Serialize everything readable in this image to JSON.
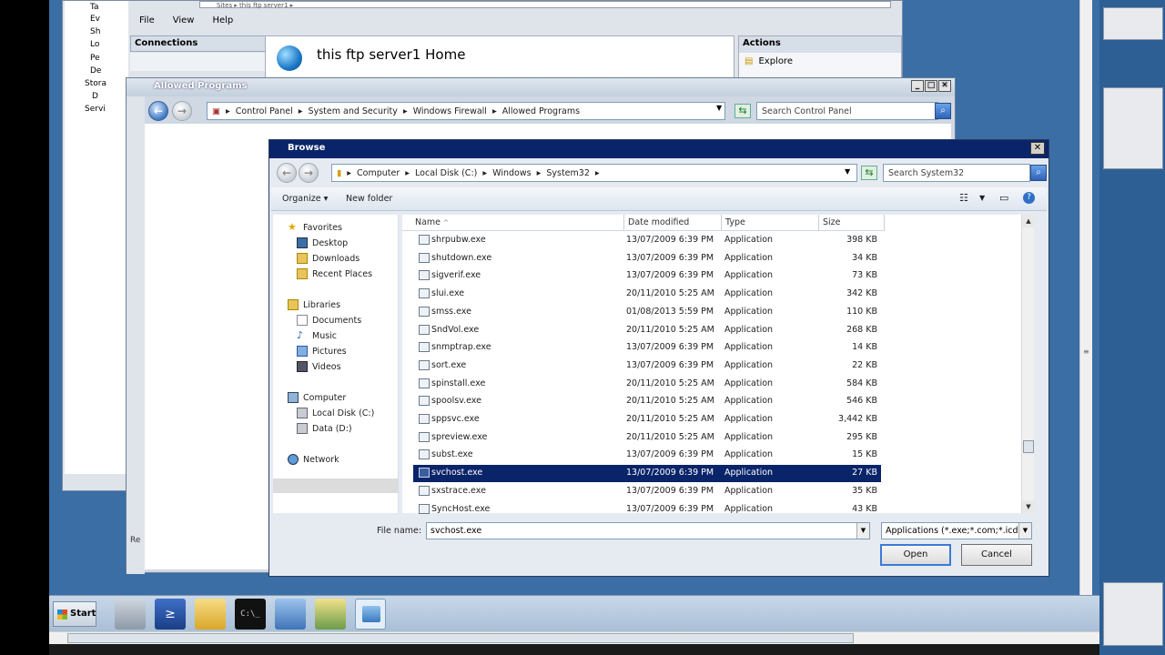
{
  "iis": {
    "menu": [
      "File",
      "View",
      "Help"
    ],
    "tree_items": [
      "Ta",
      "Ev",
      "Sh",
      "Lo",
      "Pe",
      "De",
      "Stora",
      "D",
      "Servi"
    ],
    "connections_label": "Connections",
    "home_title": "this ftp server1 Home",
    "actions_label": "Actions",
    "explore_label": "Explore",
    "address_crumb": "Sites  ▸  this ftp server1  ▸"
  },
  "allowed_programs": {
    "title": "Allowed Programs",
    "crumbs": [
      "Control Panel",
      "System and Security",
      "Windows Firewall",
      "Allowed Programs"
    ],
    "search_placeholder": "Search Control Panel",
    "left_text": "Re"
  },
  "browse": {
    "title": "Browse",
    "crumbs": [
      "Computer",
      "Local Disk (C:)",
      "Windows",
      "System32"
    ],
    "search_placeholder": "Search System32",
    "organize_label": "Organize ▾",
    "new_folder_label": "New folder",
    "nav": {
      "favorites": "Favorites",
      "desktop": "Desktop",
      "downloads": "Downloads",
      "recent": "Recent Places",
      "libraries": "Libraries",
      "documents": "Documents",
      "music": "Music",
      "pictures": "Pictures",
      "videos": "Videos",
      "computer": "Computer",
      "local_disk": "Local Disk (C:)",
      "data": "Data (D:)",
      "network": "Network"
    },
    "columns": {
      "name": "Name",
      "date": "Date modified",
      "type": "Type",
      "size": "Size"
    },
    "files": [
      {
        "name": "shrpubw.exe",
        "date": "13/07/2009 6:39 PM",
        "type": "Application",
        "size": "398 KB"
      },
      {
        "name": "shutdown.exe",
        "date": "13/07/2009 6:39 PM",
        "type": "Application",
        "size": "34 KB"
      },
      {
        "name": "sigverif.exe",
        "date": "13/07/2009 6:39 PM",
        "type": "Application",
        "size": "73 KB"
      },
      {
        "name": "slui.exe",
        "date": "20/11/2010 5:25 AM",
        "type": "Application",
        "size": "342 KB"
      },
      {
        "name": "smss.exe",
        "date": "01/08/2013 5:59 PM",
        "type": "Application",
        "size": "110 KB"
      },
      {
        "name": "SndVol.exe",
        "date": "20/11/2010 5:25 AM",
        "type": "Application",
        "size": "268 KB"
      },
      {
        "name": "snmptrap.exe",
        "date": "13/07/2009 6:39 PM",
        "type": "Application",
        "size": "14 KB"
      },
      {
        "name": "sort.exe",
        "date": "13/07/2009 6:39 PM",
        "type": "Application",
        "size": "22 KB"
      },
      {
        "name": "spinstall.exe",
        "date": "20/11/2010 5:25 AM",
        "type": "Application",
        "size": "584 KB"
      },
      {
        "name": "spoolsv.exe",
        "date": "20/11/2010 5:25 AM",
        "type": "Application",
        "size": "546 KB"
      },
      {
        "name": "sppsvc.exe",
        "date": "20/11/2010 5:25 AM",
        "type": "Application",
        "size": "3,442 KB"
      },
      {
        "name": "spreview.exe",
        "date": "20/11/2010 5:25 AM",
        "type": "Application",
        "size": "295 KB"
      },
      {
        "name": "subst.exe",
        "date": "13/07/2009 6:39 PM",
        "type": "Application",
        "size": "15 KB"
      },
      {
        "name": "svchost.exe",
        "date": "13/07/2009 6:39 PM",
        "type": "Application",
        "size": "27 KB"
      },
      {
        "name": "sxstrace.exe",
        "date": "13/07/2009 6:39 PM",
        "type": "Application",
        "size": "35 KB"
      },
      {
        "name": "SyncHost.exe",
        "date": "13/07/2009 6:39 PM",
        "type": "Application",
        "size": "43 KB"
      }
    ],
    "selected_index": 13,
    "file_name_label": "File name:",
    "file_name_value": "svchost.exe",
    "file_type_value": "Applications (*.exe;*.com;*.icd)",
    "open_label": "Open",
    "cancel_label": "Cancel"
  },
  "taskbar": {
    "start_label": "Start",
    "icons": [
      "server-manager-icon",
      "powershell-icon",
      "explorer-icon",
      "cmd-icon",
      "network-icon",
      "security-icon",
      "control-panel-icon"
    ]
  },
  "colors": {
    "selection": "#0a246a",
    "desktop": "#3a6ea5",
    "titlebar": "#0a246a"
  }
}
